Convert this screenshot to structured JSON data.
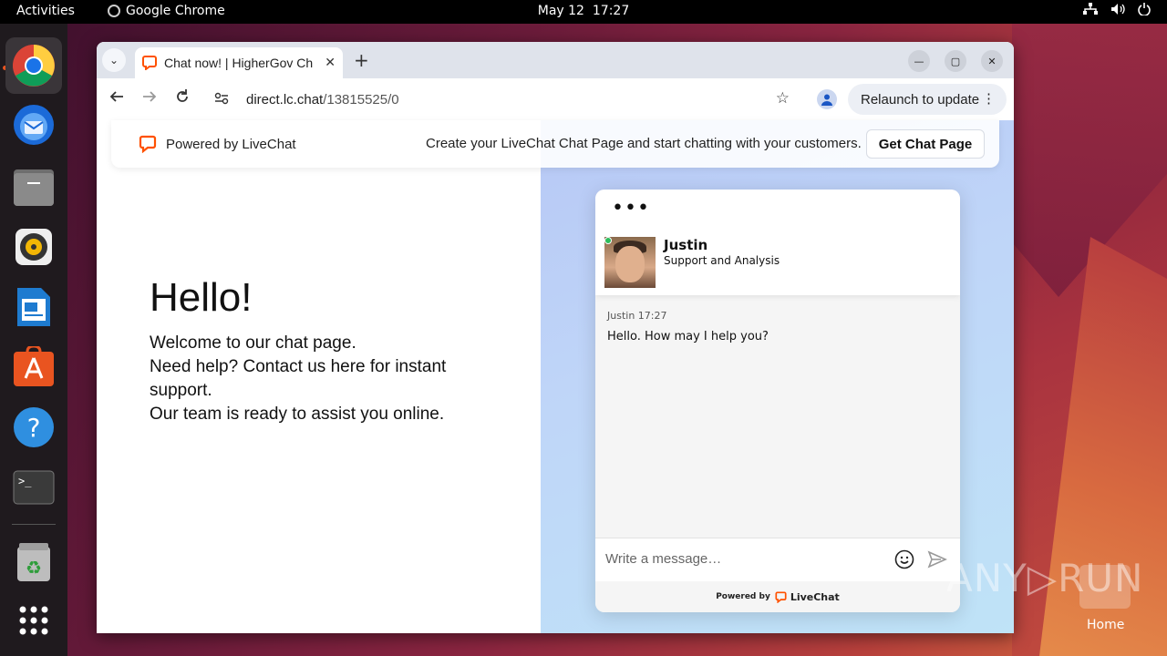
{
  "topbar": {
    "activities": "Activities",
    "app_name": "Google Chrome",
    "date": "May 12",
    "time": "17:27"
  },
  "dock": {
    "items": [
      {
        "name": "Google Chrome",
        "icon": "chrome-icon"
      },
      {
        "name": "Thunderbird",
        "icon": "thunderbird-icon"
      },
      {
        "name": "Files",
        "icon": "files-icon"
      },
      {
        "name": "Rhythmbox",
        "icon": "rhythmbox-icon"
      },
      {
        "name": "LibreOffice Writer",
        "icon": "writer-icon"
      },
      {
        "name": "Ubuntu Software",
        "icon": "software-icon"
      },
      {
        "name": "Help",
        "icon": "help-icon"
      },
      {
        "name": "Terminal",
        "icon": "terminal-icon"
      },
      {
        "name": "Trash",
        "icon": "trash-icon"
      },
      {
        "name": "Show Applications",
        "icon": "apps-grid-icon"
      }
    ]
  },
  "browser": {
    "tab_title": "Chat now! | HigherGov Ch",
    "url_host": "direct.lc.chat",
    "url_path": "/13815525/0",
    "relaunch_label": "Relaunch to update"
  },
  "banner": {
    "powered": "Powered by LiveChat",
    "promo": "Create your LiveChat Chat Page and start chatting with your customers.",
    "cta": "Get Chat Page"
  },
  "page": {
    "hello": "Hello!",
    "welcome_lines": [
      "Welcome to our chat page.",
      "Need help? Contact us here for instant support.",
      "Our team is ready to assist you online."
    ]
  },
  "chat": {
    "menu": "•••",
    "agent_name": "Justin",
    "agent_role": "Support and Analysis",
    "message_meta": "Justin 17:27",
    "message_text": "Hello. How may I help you?",
    "input_placeholder": "Write a message…",
    "footer_powered": "Powered by",
    "footer_brand": "LiveChat"
  },
  "desktop": {
    "watermark": "ANY▷RUN",
    "home_label": "Home"
  },
  "colors": {
    "livechat_orange": "#ff5100",
    "online_green": "#2dbd5b",
    "ubuntu_orange": "#e95420"
  }
}
